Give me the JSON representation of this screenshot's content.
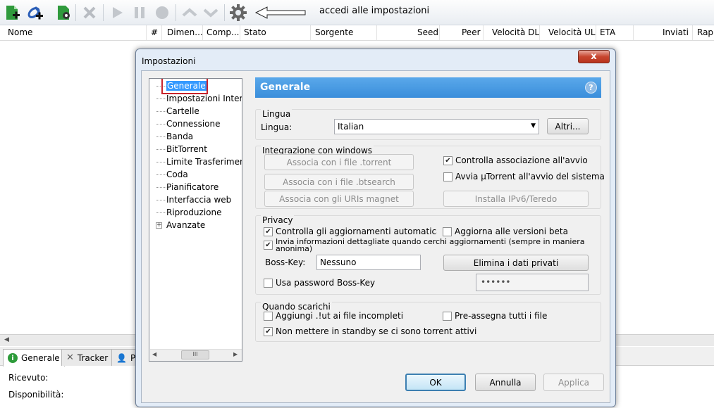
{
  "toolbar": {
    "icons": [
      "add-torrent-icon",
      "add-url-icon",
      "create-torrent-icon",
      "remove-icon",
      "start-icon",
      "pause-icon",
      "stop-icon",
      "move-up-icon",
      "move-down-icon",
      "settings-icon"
    ],
    "hint": "accedi alle impostazioni"
  },
  "columns": [
    "Nome",
    "#",
    "Dimen...",
    "Comp...",
    "Stato",
    "Sorgente",
    "Seed",
    "Peer",
    "Velocità DL",
    "Velocità UL",
    "ETA",
    "Inviati",
    "Rap."
  ],
  "bottom": {
    "tabs": [
      "Generale",
      "Tracker",
      "P"
    ],
    "labels": [
      "Ricevuto:",
      "Disponibilità:"
    ]
  },
  "dialog": {
    "title": "Impostazioni",
    "close": "x",
    "tree": [
      "Generale",
      "Impostazioni Interfa",
      "Cartelle",
      "Connessione",
      "Banda",
      "BitTorrent",
      "Limite Trasferimento",
      "Coda",
      "Pianificatore",
      "Interfaccia web",
      "Riproduzione",
      "Avanzate"
    ],
    "tree_scroll_glyph": "III",
    "header": "Generale",
    "help": "?",
    "lingua": {
      "group": "Lingua",
      "label": "Lingua:",
      "value": "Italian",
      "more": "Altri..."
    },
    "integration": {
      "group": "Integrazione con windows",
      "btn_torrent": "Associa con i file .torrent",
      "btn_btsearch": "Associa con i file .btsearch",
      "btn_magnet": "Associa con gli URIs magnet",
      "btn_ipv6": "Installa IPv6/Teredo",
      "chk_assoc": "Controlla associazione all'avvio",
      "chk_start": "Avvia µTorrent all'avvio del sistema"
    },
    "privacy": {
      "group": "Privacy",
      "chk_updates": "Controlla gli aggiornamenti automaticamente",
      "chk_beta": "Aggiorna alle versioni beta",
      "chk_info": "Invia informazioni dettagliate quando cerchi aggiornamenti (sempre in maniera anonima)",
      "bosskey_label": "Boss-Key:",
      "bosskey_value": "Nessuno",
      "btn_clear": "Elimina i dati privati",
      "chk_password": "Usa password Boss-Key",
      "password": "••••••"
    },
    "downloads": {
      "group": "Quando scarichi",
      "chk_ut": "Aggiungi .!ut ai file incompleti",
      "chk_prealloc": "Pre-assegna tutti i file",
      "chk_standby": "Non mettere in standby se ci sono torrent attivi"
    },
    "buttons": {
      "ok": "OK",
      "cancel": "Annulla",
      "apply": "Applica"
    }
  }
}
